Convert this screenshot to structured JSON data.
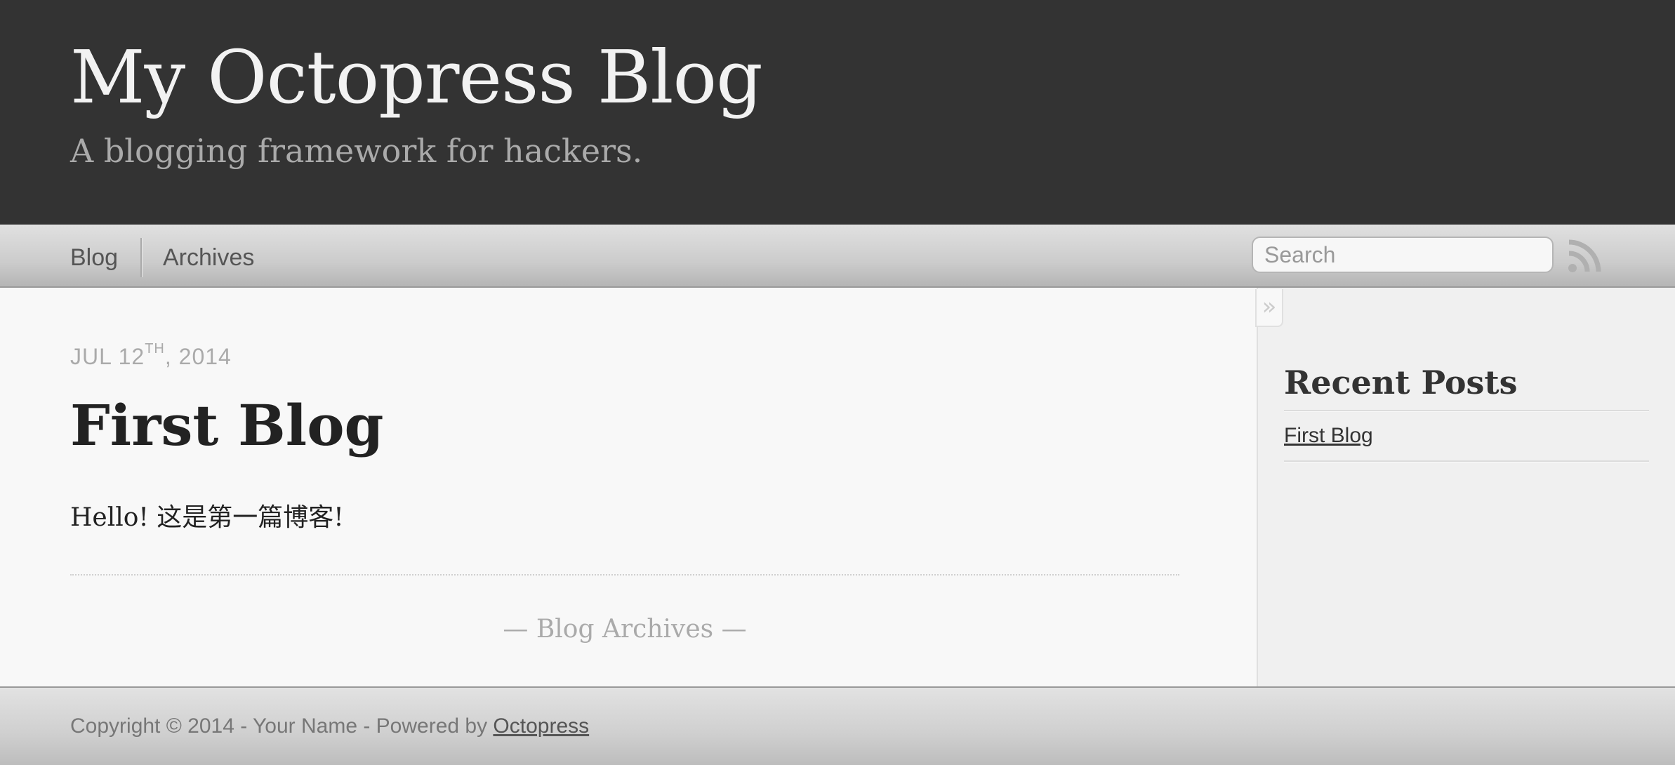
{
  "header": {
    "title": "My Octopress Blog",
    "subtitle": "A blogging framework for hackers."
  },
  "nav": {
    "items": [
      {
        "label": "Blog"
      },
      {
        "label": "Archives"
      }
    ],
    "search_placeholder": "Search",
    "rss_icon": "rss-icon"
  },
  "post": {
    "date_month_day": "JUL 12",
    "date_suffix": "TH",
    "date_year": ", 2014",
    "title": "First Blog",
    "body": "Hello! 这是第一篇博客!",
    "archives_link": "— Blog Archives —"
  },
  "sidebar": {
    "toggle_glyph": "»",
    "heading": "Recent Posts",
    "posts": [
      {
        "label": "First Blog"
      }
    ]
  },
  "footer": {
    "text": "Copyright © 2014 - Your Name - Powered by ",
    "link_label": "Octopress"
  },
  "colors": {
    "header_bg": "#333333",
    "header_title": "#f2f2f2",
    "header_subtitle": "#aaaaaa",
    "page_bg": "#f8f8f8"
  }
}
